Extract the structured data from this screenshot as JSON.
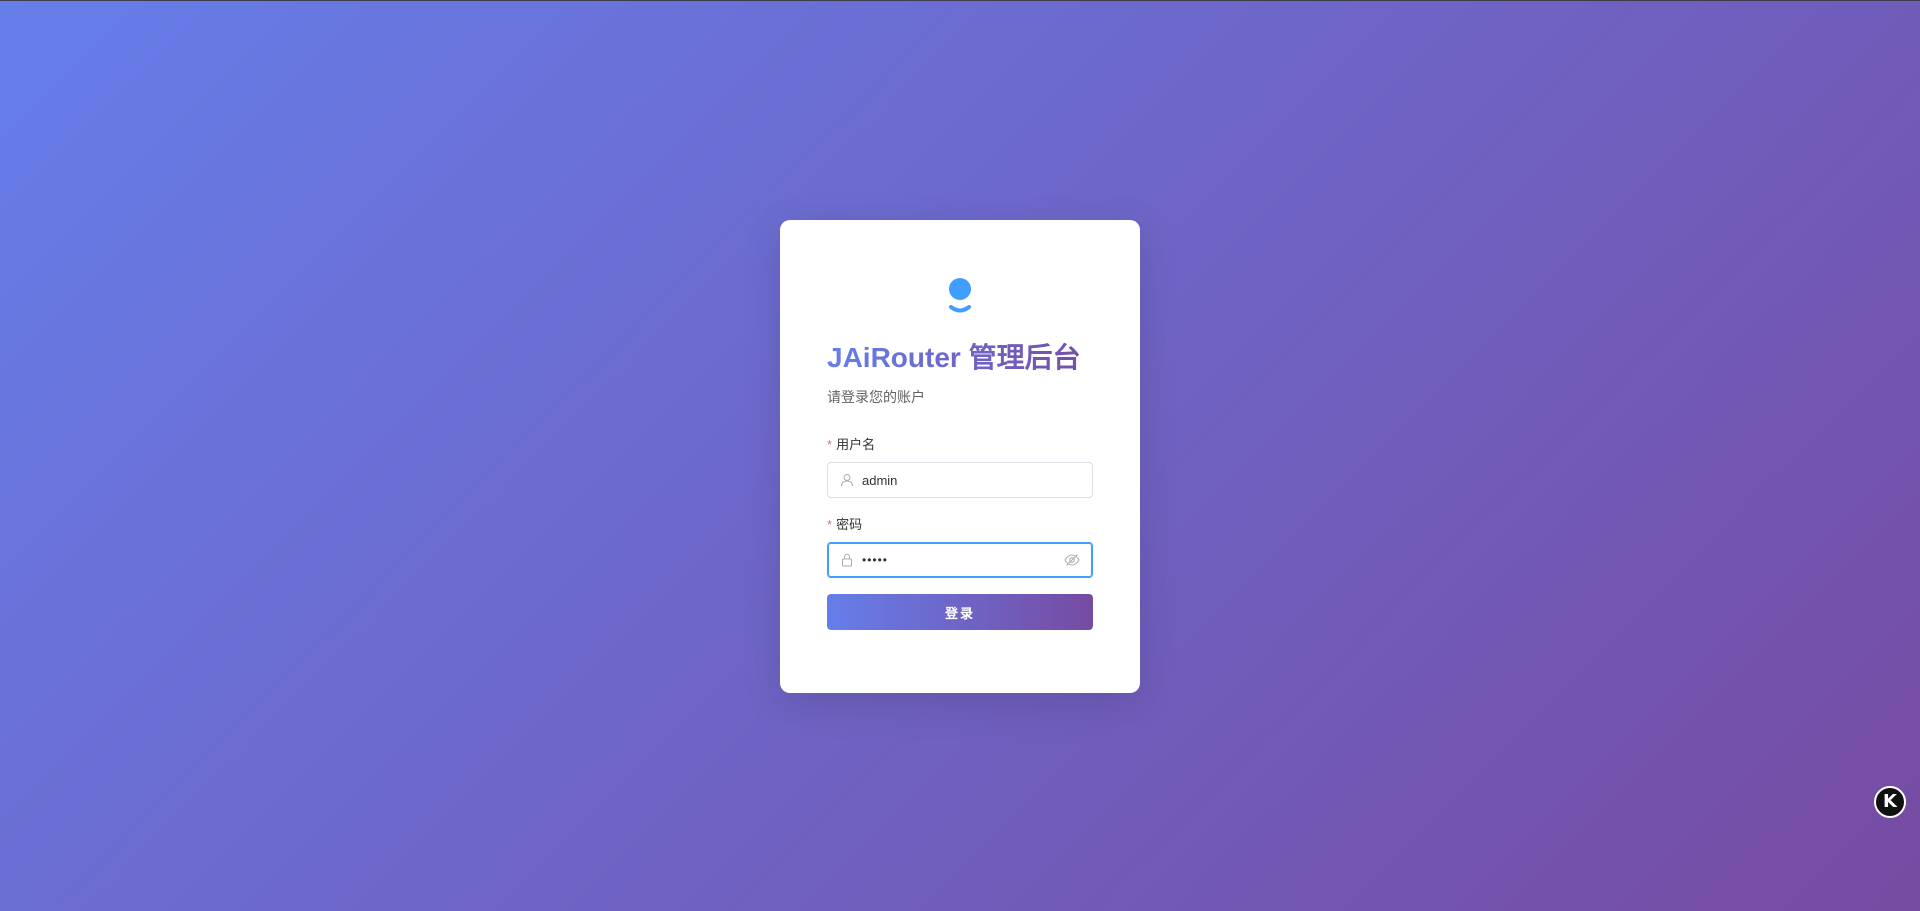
{
  "app": {
    "title": "JAiRouter 管理后台",
    "subtitle": "请登录您的账户"
  },
  "form": {
    "username": {
      "label": "用户名",
      "required_mark": "*",
      "value": "admin",
      "icon": "user-icon"
    },
    "password": {
      "label": "密码",
      "required_mark": "*",
      "value": "•••••",
      "icon": "lock-icon",
      "toggle_icon": "eye-off-icon"
    },
    "submit_label": "登录"
  },
  "floating_widget": {
    "label": "K",
    "icon": "k-badge-icon"
  },
  "colors": {
    "gradient_start": "#667eea",
    "gradient_end": "#764ba2",
    "logo": "#409eff",
    "focus_border": "#409eff",
    "required": "#f56c6c"
  }
}
